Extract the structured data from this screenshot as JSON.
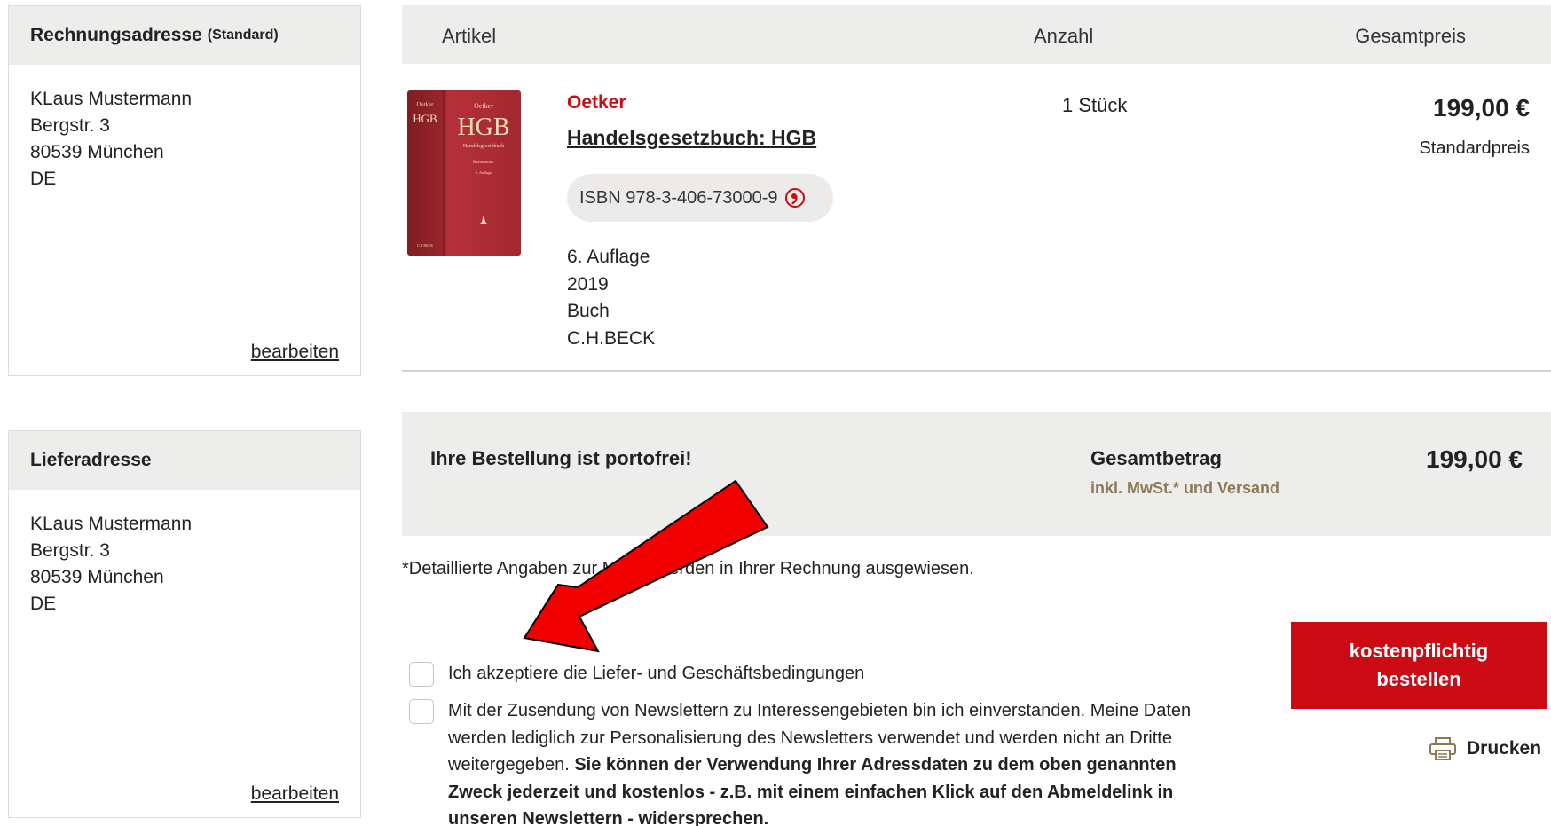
{
  "billing": {
    "title": "Rechnungsadresse",
    "badge": "(Standard)",
    "lines": [
      "KLaus Mustermann",
      "Bergstr. 3",
      "80539 München",
      "DE"
    ],
    "edit": "bearbeiten"
  },
  "shipping": {
    "title": "Lieferadresse",
    "lines": [
      "KLaus Mustermann",
      "Bergstr. 3",
      "80539 München",
      "DE"
    ],
    "edit": "bearbeiten"
  },
  "table": {
    "headers": {
      "article": "Artikel",
      "quantity": "Anzahl",
      "total": "Gesamtpreis"
    }
  },
  "product": {
    "brand": "Oetker",
    "title": "Handelsgesetzbuch: HGB",
    "isbn": "ISBN 978-3-406-73000-9",
    "meta": [
      "6. Auflage",
      "2019",
      "Buch",
      "C.H.BECK"
    ],
    "quantity": "1 Stück",
    "price": "199,00 €",
    "price_note": "Standardpreis",
    "cover": {
      "author": "Oetker",
      "short": "HGB",
      "subtitle": "Handelsgesetzbuch",
      "kind": "Kommentar",
      "edition": "6. Auflage",
      "publisher": "C.H.BECK",
      "color": "#a4282f"
    }
  },
  "summary": {
    "shipping_free": "Ihre Bestellung ist portofrei!",
    "total_label": "Gesamtbetrag",
    "total_note": "inkl. MwSt.* und Versand",
    "total_price": "199,00 €"
  },
  "footnote": "*Detaillierte Angaben zur MwSt. werden in Ihrer Rechnung ausgewiesen.",
  "consents": {
    "terms": "Ich akzeptiere die Liefer- und Geschäftsbedingungen",
    "newsletter_plain": "Mit der Zusendung von Newslettern zu Interessengebieten bin ich einverstanden. Meine Daten werden lediglich zur Personalisierung des Newsletters verwendet und werden nicht an Dritte weitergegeben.",
    "newsletter_bold": "Sie können der Verwendung Ihrer Adressdaten zu dem oben genannten Zweck jederzeit und kostenlos - z.B. mit einem einfachen Klick auf den Abmeldelink in unseren Newslettern - widersprechen."
  },
  "actions": {
    "order_line1": "kostenpflichtig",
    "order_line2": "bestellen",
    "print": "Drucken"
  },
  "colors": {
    "accent": "#cc0a14",
    "panel": "#ededeb",
    "gold": "#8d7a55"
  },
  "icons": {
    "isbn": "copy-icon",
    "print": "printer-icon",
    "annotation": "red-arrow"
  }
}
